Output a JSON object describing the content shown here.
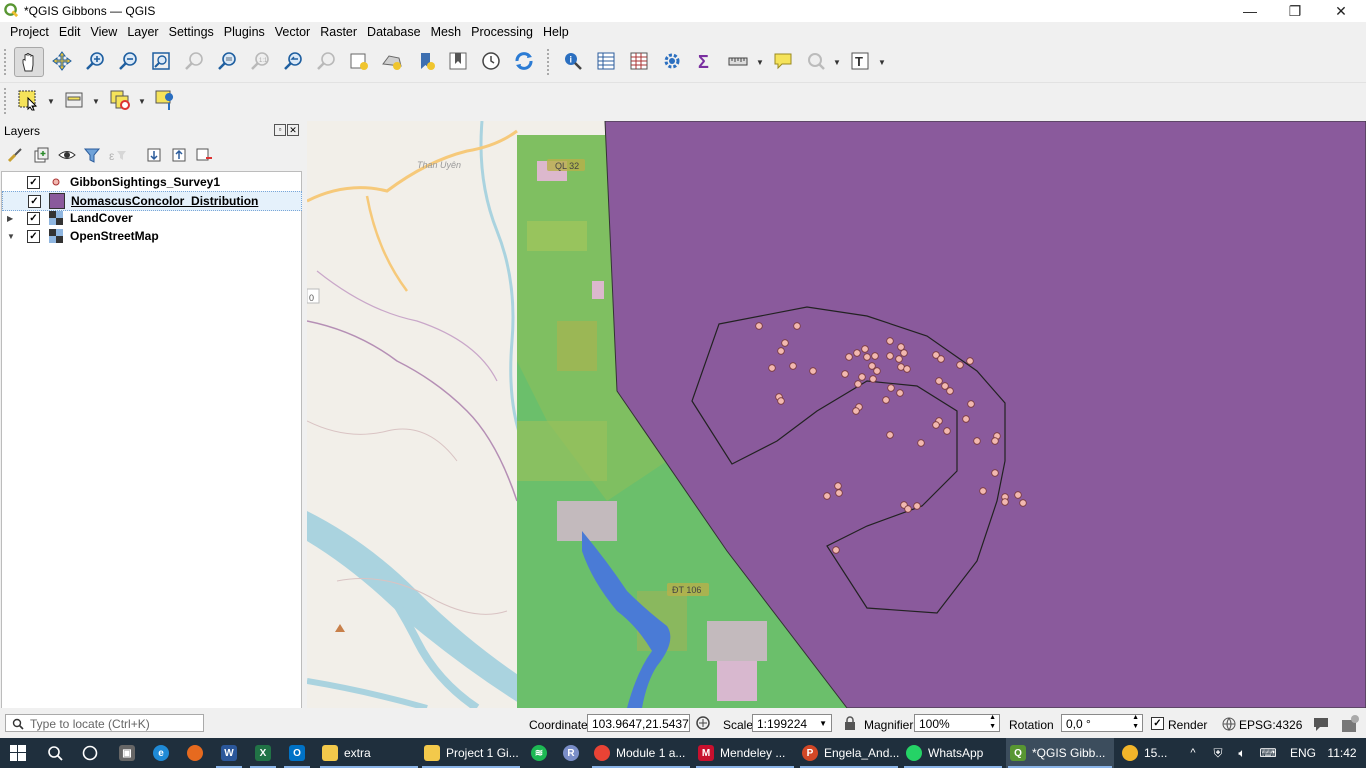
{
  "window": {
    "title": "*QGIS Gibbons — QGIS",
    "minimize": "—",
    "restore": "❐",
    "close": "✕"
  },
  "menu": [
    "Project",
    "Edit",
    "View",
    "Layer",
    "Settings",
    "Plugins",
    "Vector",
    "Raster",
    "Database",
    "Mesh",
    "Processing",
    "Help"
  ],
  "layers_panel": {
    "title": "Layers",
    "items": [
      {
        "name": "GibbonSightings_Survey1",
        "checked": true,
        "symbol": "point"
      },
      {
        "name": "NomascusConcolor_Distribution",
        "checked": true,
        "symbol": "polygon",
        "selected": true
      },
      {
        "name": "LandCover",
        "checked": true,
        "symbol": "raster",
        "expandable": true
      },
      {
        "name": "OpenStreetMap",
        "checked": true,
        "symbol": "raster",
        "expanded": true
      }
    ]
  },
  "map": {
    "labels": {
      "town": "Than Uyên",
      "road1": "QL 32",
      "road2": "ĐT 106",
      "edge": "0"
    },
    "colors": {
      "distribution_fill": "#8a5a9c",
      "sighting_fill": "#f2b8b0",
      "landcover_green": "#6bbf6b",
      "water": "#4a7bd6"
    }
  },
  "status": {
    "locate_placeholder": "Type to locate (Ctrl+K)",
    "coordinate_label": "Coordinate",
    "coordinate_value": "103.9647,21.5437",
    "scale_label": "Scale",
    "scale_value": "1:199224",
    "magnifier_label": "Magnifier",
    "magnifier_value": "100%",
    "rotation_label": "Rotation",
    "rotation_value": "0,0 °",
    "render_label": "Render",
    "render_checked": true,
    "crs": "EPSG:4326"
  },
  "taskbar": {
    "apps": [
      {
        "label": "extra",
        "color": "#f3c94b"
      },
      {
        "label": "Project 1 Gi...",
        "color": "#f3c94b"
      },
      {
        "label": "Module 1 a...",
        "color": "#e94335"
      },
      {
        "label": "Mendeley ...",
        "color": "#c8102e"
      },
      {
        "label": "Engela_And...",
        "color": "#d24726"
      },
      {
        "label": "WhatsApp",
        "color": "#25d366"
      },
      {
        "label": "*QGIS Gibb...",
        "color": "#589632"
      }
    ],
    "weather": "15...",
    "language": "ENG",
    "time": "11:42"
  }
}
